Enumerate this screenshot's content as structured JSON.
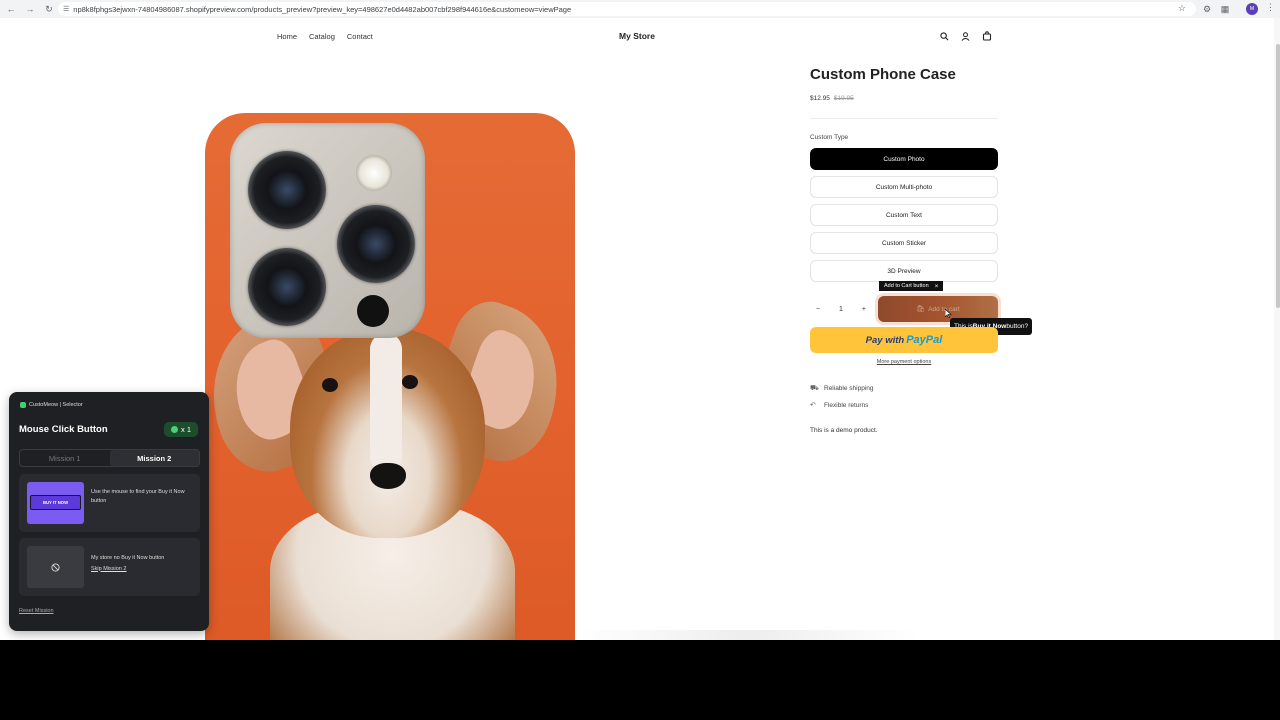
{
  "browser": {
    "url": "np8k8fphgs3ejwxn-74804986087.shopifypreview.com/products_preview?preview_key=498627e0d4482ab007cbf298f944616e&customeow=viewPage",
    "profile_initial": "M"
  },
  "store": {
    "title": "My Store",
    "nav": [
      "Home",
      "Catalog",
      "Contact"
    ]
  },
  "product": {
    "title": "Custom Phone Case",
    "price": "$12.95",
    "compare_price": "$19.95",
    "option_label": "Custom Type",
    "options": [
      {
        "label": "Custom Photo",
        "selected": true
      },
      {
        "label": "Custom Multi-photo",
        "selected": false
      },
      {
        "label": "Custom Text",
        "selected": false
      },
      {
        "label": "Custom Sticker",
        "selected": false
      },
      {
        "label": "3D Preview",
        "selected": false
      }
    ],
    "quantity": "1",
    "qty_minus": "−",
    "qty_plus": "+",
    "add_to_cart": "Add to cart",
    "paypal_prefix": "Pay with",
    "paypal_brand": "PayPal",
    "more_payment": "More payment options",
    "features": [
      "Reliable shipping",
      "Flexible returns"
    ],
    "description": "This is a demo product."
  },
  "overlay": {
    "tag_label": "Add to Cart button",
    "tag_close": "×",
    "tooltip_prefix": "This is ",
    "tooltip_bold": "Buy it Now",
    "tooltip_suffix": " button?"
  },
  "panel": {
    "brand": "CustoMeow | Selector",
    "title": "Mouse Click Button",
    "badge": "x 1",
    "tabs": [
      {
        "label": "Mission 1",
        "active": false
      },
      {
        "label": "Mission 2",
        "active": true
      }
    ],
    "card1": {
      "thumb_label": "BUY IT NOW",
      "text": "Use the mouse to find your Buy it Now button"
    },
    "card2": {
      "text": "My store no Buy it Now button",
      "link": "Skip Mission 2"
    },
    "reset": "Reset Mission"
  },
  "colors": {
    "accent_black": "#000000",
    "paypal_yellow": "#ffc43a",
    "add_cart_brown": "#a4532f",
    "panel_bg": "#1f2024",
    "badge_green": "#1e4d2e",
    "case_orange": "#e3622e"
  }
}
